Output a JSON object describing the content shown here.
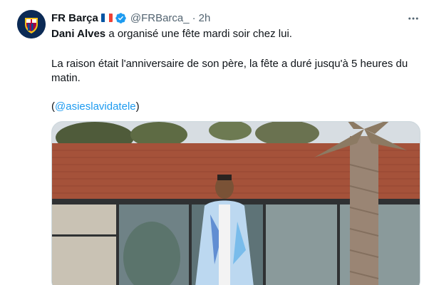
{
  "tweet": {
    "display_name": "FR Barça",
    "handle": "@FRBarca_",
    "separator": "·",
    "time": "2h",
    "line1_bold": "Dani Alves",
    "line1_rest": " a organisé une fête mardi soir chez lui.",
    "line2": "La raison était l'anniversaire de son père, la fête a duré jusqu'à 5 heures du matin.",
    "line3_open": "(",
    "line3_link": "@asieslavidatele",
    "line3_close": ")"
  },
  "icons": {
    "avatar": "fc-barcelona-crest",
    "flag": "france-flag",
    "verified": "verified-badge-icon",
    "more": "more-options-icon"
  },
  "colors": {
    "link": "#1d9bf0",
    "secondary_text": "#536471",
    "verified": "#1d9bf0",
    "avatar_bg": "#0b2a55"
  }
}
